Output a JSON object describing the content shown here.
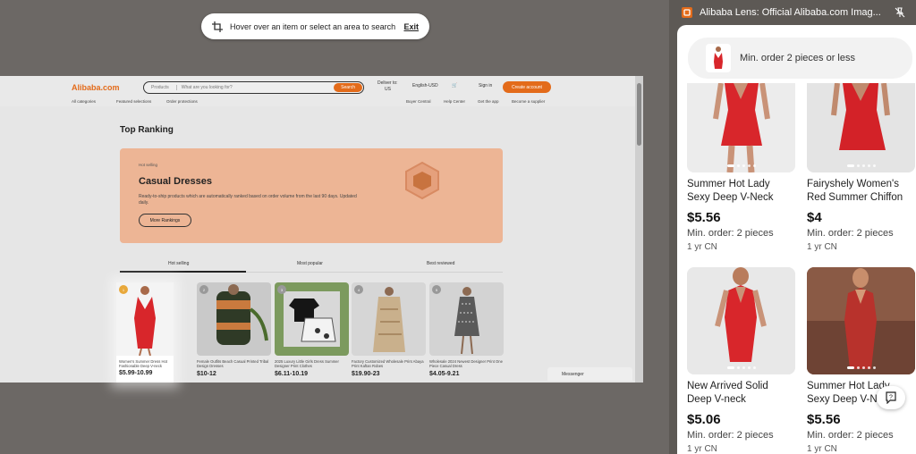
{
  "overlay": {
    "hint": "Hover over an item or select an area to search",
    "exit_label": "Exit"
  },
  "site": {
    "logo": "Alibaba.com",
    "search_category": "Products",
    "search_placeholder": "What are you looking for?",
    "search_button": "Search",
    "deliver_to_label": "Deliver to:",
    "deliver_to_value": "US",
    "language": "English-USD",
    "sign_in": "Sign in",
    "create_account": "Create account",
    "subnav_left": [
      "All categories",
      "Featured selections",
      "Order protections"
    ],
    "subnav_right": [
      "Buyer Central",
      "Help Center",
      "Get the app",
      "Become a supplier"
    ],
    "section_title": "Top Ranking",
    "banner": {
      "tag": "Hot selling",
      "title": "Casual Dresses",
      "description": "Ready-to-ship products which are automatically ranked based on order volume from the last 90 days. Updated daily.",
      "button": "More Rankings"
    },
    "tabs": [
      "Hot selling",
      "Most popular",
      "Best reviewed"
    ],
    "products": [
      {
        "rank": "1",
        "name": "Women's Summer Dress Hot Fashionable Deep V-neck",
        "price": "$5.99-10.99"
      },
      {
        "rank": "2",
        "name": "Female Outfits Beach Casual Printed Tribal Design Dresses",
        "price": "$10-12"
      },
      {
        "rank": "3",
        "name": "2025 Luxury Little Girls Dress Summer Designer Print Clothes",
        "price": "$6.11-10.19"
      },
      {
        "rank": "4",
        "name": "Factory Customized Wholesale Print Abaya Print Kaftan Robes",
        "price": "$19.90-23"
      },
      {
        "rank": "5",
        "name": "Wholesale 2024 Newest Designer Print One Piece Casual Dress",
        "price": "$4.05-9.21"
      }
    ],
    "messenger": "Messenger"
  },
  "panel": {
    "title": "Alibaba Lens: Official Alibaba.com Imag...",
    "filter_chip": "Min. order 2 pieces or less",
    "results": [
      {
        "title": "Summer Hot Lady Sexy Deep V-Neck Bodycon",
        "price": "$5.56",
        "moq": "Min. order: 2 pieces",
        "meta": "1 yr  CN"
      },
      {
        "title": "Fairyshely Women's Red Summer Chiffon Dress",
        "price": "$4",
        "moq": "Min. order: 2 pieces",
        "meta": "1 yr  CN"
      },
      {
        "title": "New Arrived Solid Deep V-neck Sleeveless",
        "price": "$5.06",
        "moq": "Min. order: 2 pieces",
        "meta": "1 yr  CN"
      },
      {
        "title": "Summer Hot Lady Sexy Deep V-Neck Bodycon",
        "price": "$5.56",
        "moq": "Min. order: 2 pieces",
        "meta": "1 yr  CN"
      }
    ]
  },
  "colors": {
    "accent": "#e36b1a",
    "dress_red": "#d8262b",
    "panel_bg": "#5d5955"
  }
}
